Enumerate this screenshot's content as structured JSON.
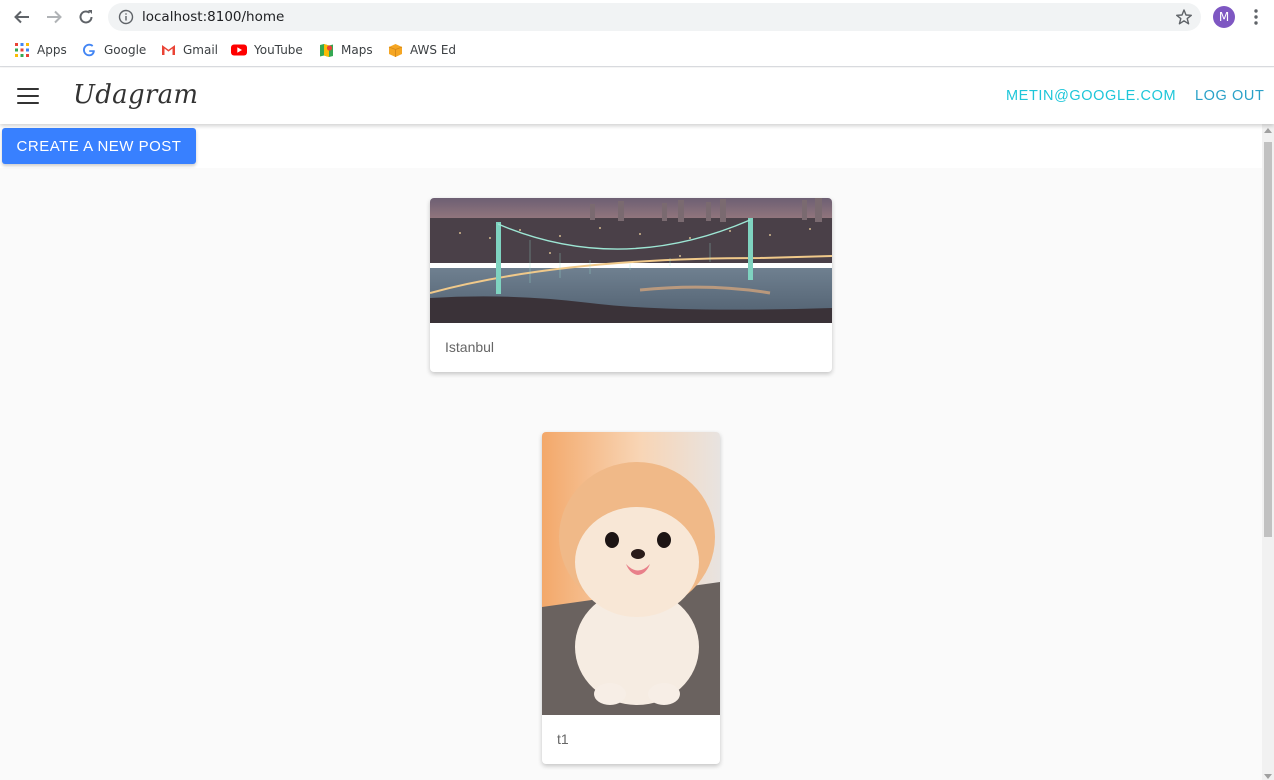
{
  "browser": {
    "url": "localhost:8100/home",
    "profile_initial": "M",
    "bookmarks": [
      {
        "label": "Apps",
        "icon": "apps-grid-icon"
      },
      {
        "label": "Google",
        "icon": "google-icon"
      },
      {
        "label": "Gmail",
        "icon": "gmail-icon"
      },
      {
        "label": "YouTube",
        "icon": "youtube-icon"
      },
      {
        "label": "Maps",
        "icon": "maps-icon"
      },
      {
        "label": "AWS Ed",
        "icon": "aws-icon"
      }
    ]
  },
  "toolbar": {
    "brand": "Udagram",
    "email_link": "METIN@GOOGLE.COM",
    "logout_link": "LOG OUT"
  },
  "main": {
    "create_button": "CREATE A NEW POST",
    "posts": [
      {
        "caption": "Istanbul",
        "image": "bosphorus-bridge-night-photo"
      },
      {
        "caption": "t1",
        "image": "pomeranian-puppy-photo"
      }
    ]
  },
  "colors": {
    "primary": "#3880ff",
    "email_link": "#1ec6d9",
    "logout_link": "#2aa1c8",
    "avatar": "#7e57c2"
  }
}
